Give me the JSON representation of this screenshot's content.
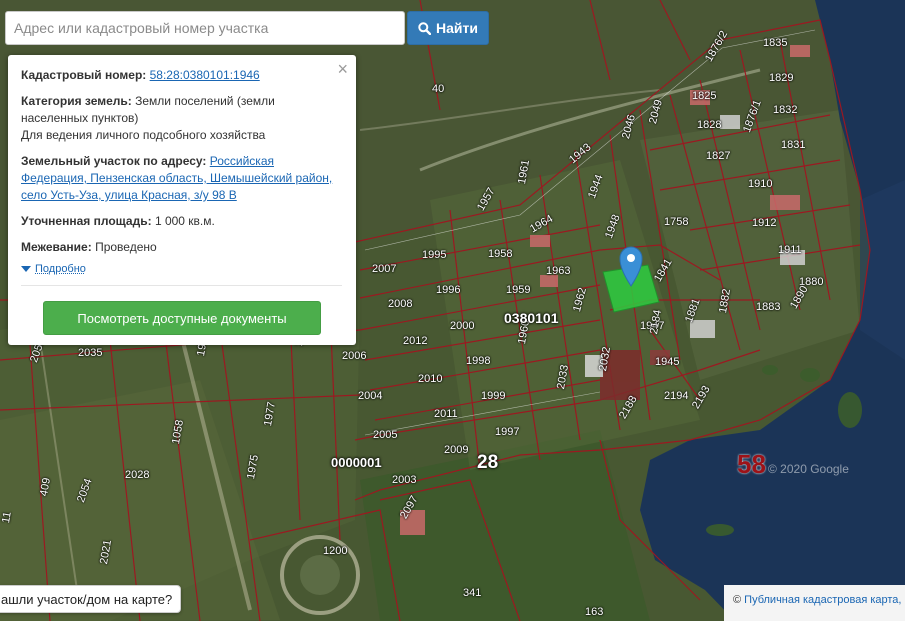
{
  "search": {
    "placeholder": "Адрес или кадастровый номер участка",
    "button_label": "Найти"
  },
  "popup": {
    "cadastral_label": "Кадастровый номер:",
    "cadastral_number": "58:28:0380101:1946",
    "category_label": "Категория земель:",
    "category_value": "Земли поселений (земли населенных пунктов)",
    "usage": "Для ведения личного подсобного хозяйства",
    "address_label": "Земельный участок по адресу:",
    "address_value": "Российская Федерация, Пензенская область, Шемышейский район, село Усть-Уза, улица Красная, з/у 98 В",
    "area_label": "Уточненная площадь:",
    "area_value": "1 000 кв.м.",
    "survey_label": "Межевание:",
    "survey_value": "Проведено",
    "details_link": "Подробно",
    "docs_button": "Посмотреть доступные документы",
    "close_symbol": "×"
  },
  "map": {
    "parcel_labels": [
      "1835",
      "1876/2",
      "1829",
      "1825",
      "1832",
      "1828",
      "1876/1",
      "1831",
      "1827",
      "1910",
      "1758",
      "1912",
      "1911",
      "1880",
      "1883",
      "1841",
      "1881",
      "1882",
      "1890",
      "1943",
      "2049",
      "2046",
      "1944",
      "1948",
      "1961",
      "1957",
      "1964",
      "1995",
      "2007",
      "1958",
      "1963",
      "1996",
      "2008",
      "1959",
      "1962",
      "2000",
      "2012",
      "1960",
      "1947",
      "2184",
      "1945",
      "2006",
      "1998",
      "2010",
      "2032",
      "2033",
      "2004",
      "1999",
      "2011",
      "2194",
      "2193",
      "2188",
      "2005",
      "1997",
      "2009",
      "2003",
      "2097",
      "1200",
      "341",
      "163",
      "2035",
      "2055",
      "1975",
      "1974",
      "1977",
      "1975",
      "2028",
      "1058",
      "2054",
      "409",
      "2021",
      "11",
      "40"
    ],
    "quarter_label": "0380101",
    "district_label": "0000001",
    "district_code": "28",
    "region_code": "58",
    "watermark": "© 2020 Google"
  },
  "bottom_prompt": "ашли участок/дом на карте?",
  "attribution": {
    "prefix": "©",
    "link": "Публичная кадастровая карта,"
  },
  "colors": {
    "boundary": "#a01620",
    "selected_parcel": "#2ecc40",
    "marker": "#3a8fd6",
    "water": "#1b3457",
    "search_button": "#337ab7",
    "docs_button": "#4cae4c"
  }
}
